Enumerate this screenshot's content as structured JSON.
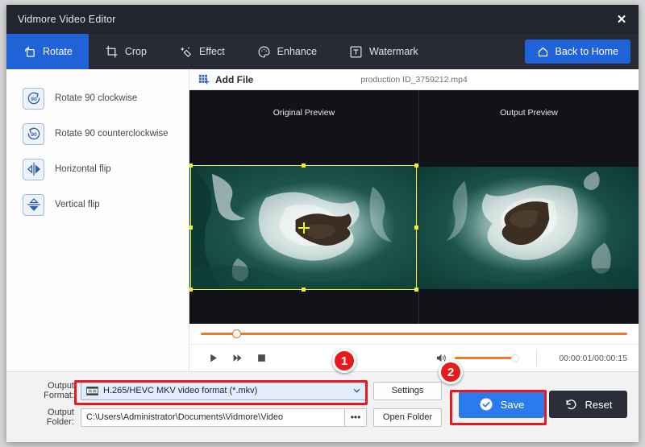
{
  "window": {
    "title": "Vidmore Video Editor",
    "close_icon": "close-icon"
  },
  "toolbar": {
    "tabs": [
      {
        "label": "Rotate",
        "icon": "rotate-icon",
        "active": true
      },
      {
        "label": "Crop",
        "icon": "crop-icon",
        "active": false
      },
      {
        "label": "Effect",
        "icon": "effect-icon",
        "active": false
      },
      {
        "label": "Enhance",
        "icon": "enhance-icon",
        "active": false
      },
      {
        "label": "Watermark",
        "icon": "watermark-icon",
        "active": false
      }
    ],
    "back_home_label": "Back to Home",
    "back_home_icon": "home-icon",
    "active_color": "#2062d8"
  },
  "sidebar": {
    "items": [
      {
        "label": "Rotate 90 clockwise",
        "icon": "rotate-cw-90-icon"
      },
      {
        "label": "Rotate 90 counterclockwise",
        "icon": "rotate-ccw-90-icon"
      },
      {
        "label": "Horizontal flip",
        "icon": "horizontal-flip-icon"
      },
      {
        "label": "Vertical flip",
        "icon": "vertical-flip-icon"
      }
    ]
  },
  "filebar": {
    "add_file_label": "Add File",
    "add_file_icon": "add-file-icon",
    "filename": "production ID_3759212.mp4"
  },
  "previews": {
    "original_title": "Original Preview",
    "output_title": "Output Preview",
    "crop_border_color": "#f3f32a"
  },
  "player": {
    "play_icon": "play-icon",
    "forward_icon": "fast-forward-icon",
    "stop_icon": "stop-icon",
    "volume_icon": "volume-icon",
    "time": "00:00:01/00:00:15",
    "seek_percent": 8.5,
    "volume_percent": 100,
    "accent_color": "#f0792a"
  },
  "output": {
    "format_label": "Output Format:",
    "format_value": "H.265/HEVC MKV video format (*.mkv)",
    "format_icon": "film-strip-icon",
    "chevron_icon": "chevron-down-icon",
    "settings_label": "Settings",
    "folder_label": "Output Folder:",
    "folder_value": "C:\\Users\\Administrator\\Documents\\Vidmore\\Video",
    "browse_label": "•••",
    "open_folder_label": "Open Folder",
    "save_label": "Save",
    "save_icon": "check-circle-icon",
    "reset_label": "Reset",
    "reset_icon": "reset-icon"
  },
  "annotations": {
    "badges": [
      {
        "number": "1"
      },
      {
        "number": "2"
      }
    ],
    "highlight_color": "#e8191c"
  }
}
